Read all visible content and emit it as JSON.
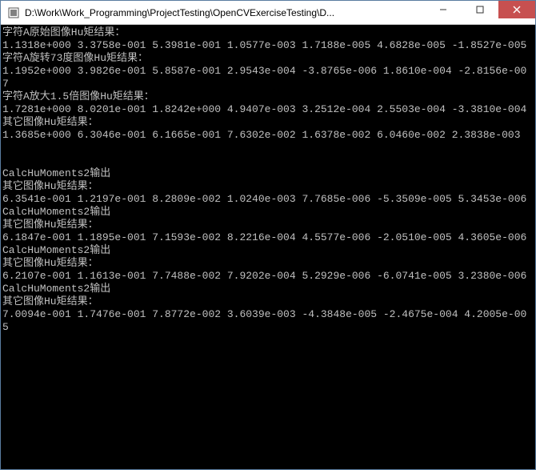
{
  "window": {
    "title": "D:\\Work\\Work_Programming\\ProjectTesting\\OpenCVExerciseTesting\\D...",
    "icon_name": "app-icon"
  },
  "console": {
    "lines": [
      "字符A原始图像Hu矩结果：",
      "1.1318e+000 3.3758e-001 5.3981e-001 1.0577e-003 1.7188e-005 4.6828e-005 -1.8527e-005",
      "字符A旋转73度图像Hu矩结果：",
      "1.1952e+000 3.9826e-001 5.8587e-001 2.9543e-004 -3.8765e-006 1.8610e-004 -2.8156e-007",
      "字符A放大1.5倍图像Hu矩结果：",
      "1.7281e+000 8.0201e-001 1.8242e+000 4.9407e-003 3.2512e-004 2.5503e-004 -3.3810e-004",
      "其它图像Hu矩结果：",
      "1.3685e+000 6.3046e-001 6.1665e-001 7.6302e-002 1.6378e-002 6.0460e-002 2.3838e-003",
      "",
      "",
      "CalcHuMoments2输出",
      "其它图像Hu矩结果：",
      "6.3541e-001 1.2197e-001 8.2809e-002 1.0240e-003 7.7685e-006 -5.3509e-005 5.3453e-006",
      "CalcHuMoments2输出",
      "其它图像Hu矩结果：",
      "6.1847e-001 1.1895e-001 7.1593e-002 8.2216e-004 4.5577e-006 -2.0510e-005 4.3605e-006",
      "CalcHuMoments2输出",
      "其它图像Hu矩结果：",
      "6.2107e-001 1.1613e-001 7.7488e-002 7.9202e-004 5.2929e-006 -6.0741e-005 3.2380e-006",
      "CalcHuMoments2输出",
      "其它图像Hu矩结果：",
      "7.0094e-001 1.7476e-001 7.8772e-002 3.6039e-003 -4.3848e-005 -2.4675e-004 4.2005e-005"
    ]
  }
}
